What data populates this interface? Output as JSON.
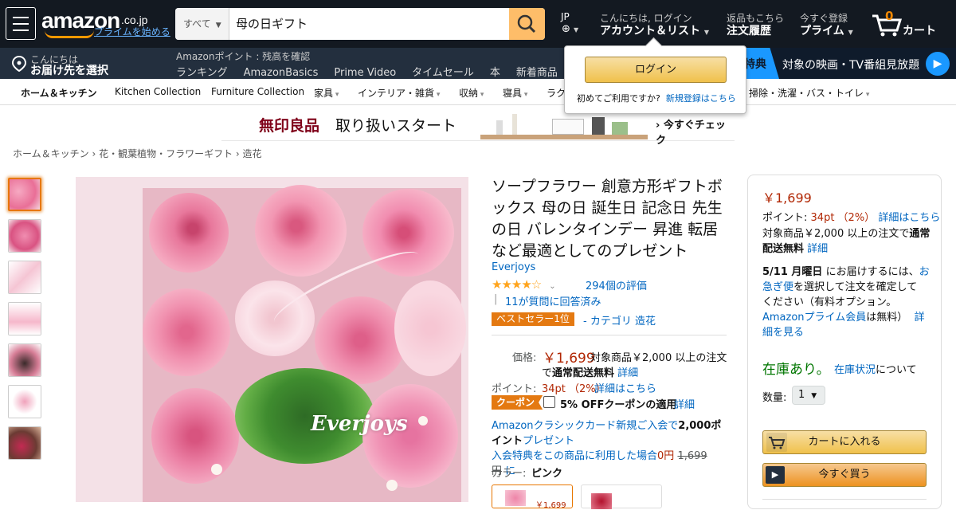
{
  "nav": {
    "logo_text": "amazon",
    "logo_suffix": ".co.jp",
    "prime_link": "プライムを始める",
    "search_category": "すべて",
    "search_value": "母の日ギフト",
    "lang": "JP",
    "account_greeting": "こんにちは, ログイン",
    "account_label": "アカウント＆リスト",
    "returns_small": "返品もこちら",
    "returns_label": "注文履歴",
    "prime_small": "今すぐ登録",
    "prime_label": "プライム",
    "cart_count": "0",
    "cart_label": "カート"
  },
  "subnav": {
    "deliver_small": "こんにちは",
    "deliver_label": "お届け先を選択",
    "points_line": "Amazonポイント : 残高を確認",
    "links": [
      "ランキング",
      "AmazonBasics",
      "Prime Video",
      "タイムセール",
      "本",
      "新着商品"
    ],
    "promo_badge": "特典",
    "promo_text": "対象の映画・TV番組見放題"
  },
  "popover": {
    "login_button": "ログイン",
    "first_time": "初めてご利用ですか?",
    "register_link": "新規登録はこちら"
  },
  "catbar": {
    "items": [
      "ホーム＆キッチン",
      "Kitchen Collection",
      "Furniture Collection",
      "家具",
      "インテリア・雑貨",
      "収納",
      "寝具",
      "ラク",
      "掃除・洗濯・バス・トイレ"
    ]
  },
  "banner": {
    "brand": "無印良品",
    "text": "取り扱いスタート",
    "link": "今すぐチェック"
  },
  "breadcrumb": [
    "ホーム＆キッチン",
    "花・観葉植物・フラワーギフト",
    "造花"
  ],
  "product": {
    "title": "ソープフラワー 創意方形ギフトボックス 母の日 誕生日 記念日 先生の日 バレンタインデー 昇進 転居など最適としてのプレゼント",
    "brand": "Everjoys",
    "rating": 4,
    "rating_count": "294個の評価",
    "answered": "11が質問に回答済み",
    "bestseller_badge": "ベストセラー1位",
    "bestseller_category": "- カテゴリ 造花",
    "price_label": "価格:",
    "price": "￥1,699",
    "shipping_text1": "対象商品￥2,000 以上の注文",
    "shipping_text2": "で",
    "shipping_bold": "通常配送無料",
    "details_link": "詳細",
    "points_label": "ポイント:",
    "points_value": "34pt （2%）",
    "points_link": "詳細はこちら",
    "coupon_badge": "クーポン",
    "coupon_text": "5% OFFクーポンの適用",
    "coupon_link": "詳細",
    "card_line1": "Amazonクラシックカード新規ご入会で",
    "card_bold": "2,000ポイント",
    "card_line2": "プレゼント",
    "card_line3": "入会特典をこの商品に利用した場合",
    "card_zero": "0円",
    "card_strike": "1,699円",
    "card_ni": "に",
    "color_label": "カラー:",
    "color_value": "ピンク",
    "swatch_price": "￥1,699",
    "image_brand": "Everjoys"
  },
  "buybox": {
    "price": "￥1,699",
    "points_label": "ポイント:",
    "points_value": "34pt （2%）",
    "points_link": "詳細はこちら",
    "shipping1": "対象商品￥2,000 以上の注文で",
    "shipping_bold1": "通常",
    "shipping_bold2": "配送無料",
    "shipping_link": "詳細",
    "delivery_date": "5/11 月曜日",
    "delivery_text1": "にお届けするには、",
    "delivery_link1": "お",
    "delivery_link2": "急ぎ便",
    "delivery_text2": "を選択して注文を確定して",
    "delivery_text3": "ください（有料オプション。",
    "prime_link": "Amazonプライム会員",
    "prime_text": "は無料）",
    "detail1": "詳",
    "detail2": "細を見る",
    "stock": "在庫あり。",
    "stock_link": "在庫状況",
    "stock_after": "について",
    "qty_label": "数量:",
    "qty_value": "1",
    "cart_button": "カートに入れる",
    "buy_button": "今すぐ買う"
  },
  "colors": {
    "nav": "#131921",
    "subnav": "#232f3e",
    "accent": "#febd69",
    "price": "#b12704",
    "link": "#0066c0",
    "stock": "#007600"
  }
}
